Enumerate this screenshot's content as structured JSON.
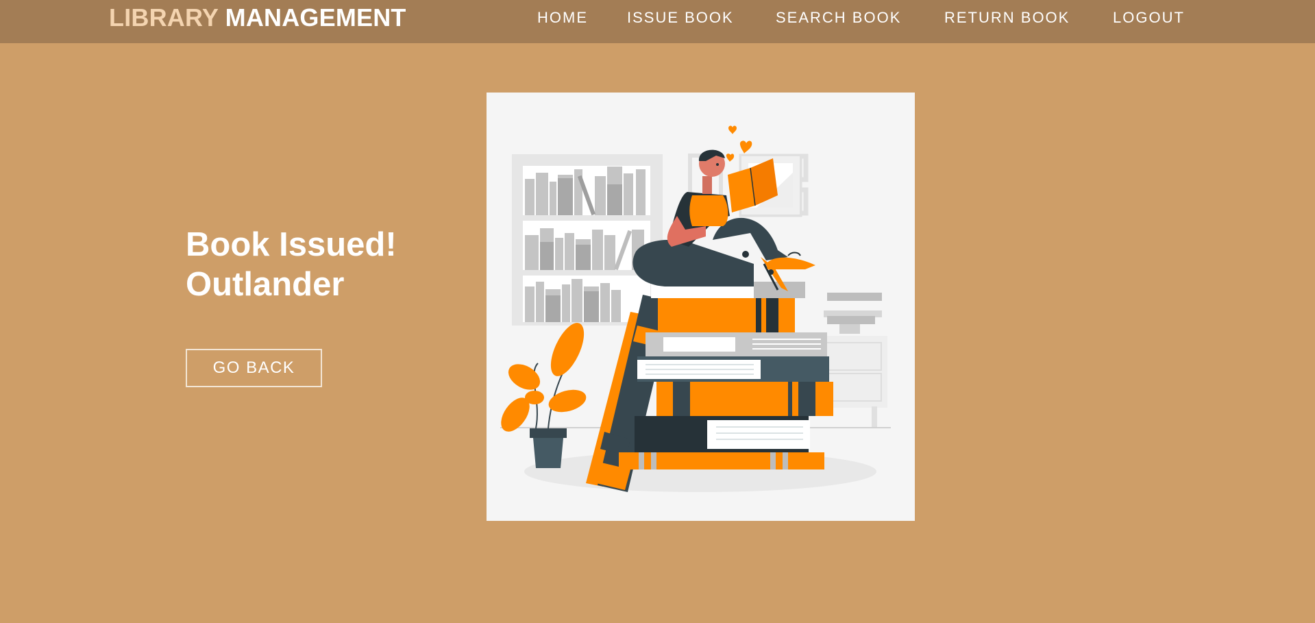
{
  "navbar": {
    "brand_part1": "LIBRARY",
    "brand_part2": "MANAGEMENT",
    "links": [
      "HOME",
      "ISSUE BOOK",
      "SEARCH BOOK",
      "RETURN BOOK",
      "LOGOUT"
    ]
  },
  "main": {
    "heading_line1": "Book Issued!",
    "heading_line2": "Outlander",
    "back_button": "GO BACK"
  },
  "colors": {
    "background": "#ce9e68",
    "navbar": "#a37d55",
    "accent_orange": "#ff8a00",
    "dark_slate": "#37474f"
  }
}
